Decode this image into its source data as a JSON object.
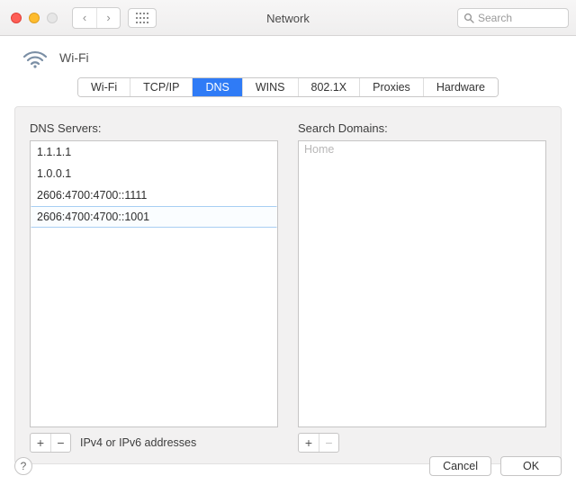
{
  "window": {
    "title": "Network"
  },
  "search": {
    "placeholder": "Search"
  },
  "service": {
    "name": "Wi-Fi"
  },
  "tabs": [
    {
      "label": "Wi-Fi",
      "selected": false
    },
    {
      "label": "TCP/IP",
      "selected": false
    },
    {
      "label": "DNS",
      "selected": true
    },
    {
      "label": "WINS",
      "selected": false
    },
    {
      "label": "802.1X",
      "selected": false
    },
    {
      "label": "Proxies",
      "selected": false
    },
    {
      "label": "Hardware",
      "selected": false
    }
  ],
  "dns": {
    "label": "DNS Servers:",
    "hint": "IPv4 or IPv6 addresses",
    "servers": [
      {
        "value": "1.1.1.1",
        "selected": false
      },
      {
        "value": "1.0.0.1",
        "selected": false
      },
      {
        "value": "2606:4700:4700::1111",
        "selected": false
      },
      {
        "value": "2606:4700:4700::1001",
        "selected": true
      }
    ]
  },
  "searchDomains": {
    "label": "Search Domains:",
    "placeholder": "Home",
    "items": []
  },
  "buttons": {
    "cancel": "Cancel",
    "ok": "OK",
    "help": "?"
  },
  "icons": {
    "back": "‹",
    "forward": "›",
    "plus": "+",
    "minus": "−"
  }
}
